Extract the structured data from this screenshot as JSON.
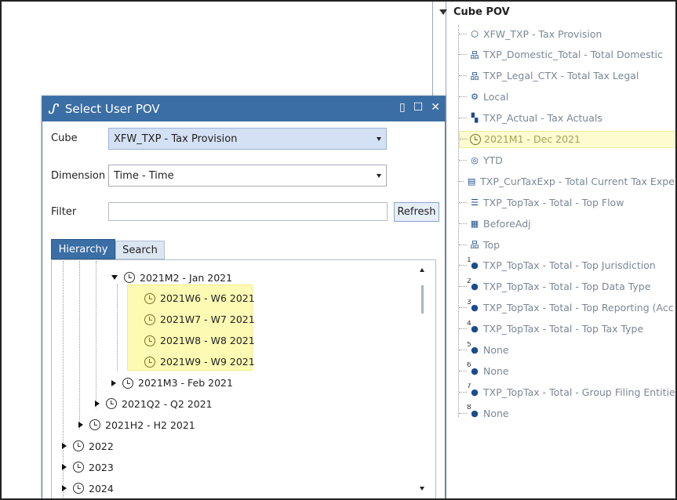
{
  "cube_pov": {
    "header": "Cube POV",
    "items": [
      {
        "label": "XFW_TXP - Tax Provision",
        "icon": "cube-icon"
      },
      {
        "label": "TXP_Domestic_Total - Total Domestic",
        "icon": "entity-hierarchy-icon"
      },
      {
        "label": "TXP_Legal_CTX - Total Tax Legal",
        "icon": "entity-hierarchy-icon"
      },
      {
        "label": "Local",
        "icon": "consolidation-icon"
      },
      {
        "label": "TXP_Actual - Tax Actuals",
        "icon": "scenario-icon"
      },
      {
        "label": "2021M1 - Dec 2021",
        "icon": "clock-icon",
        "highlighted": true
      },
      {
        "label": "YTD",
        "icon": "view-icon"
      },
      {
        "label": "TXP_CurTaxExp - Total Current Tax Exper",
        "icon": "account-icon"
      },
      {
        "label": "TXP_TopTax - Total - Top Flow",
        "icon": "flow-icon"
      },
      {
        "label": "BeforeAdj",
        "icon": "origin-icon"
      },
      {
        "label": "Top",
        "icon": "ic-hierarchy-icon"
      },
      {
        "label": "TXP_TopTax - Total - Top Jurisdiction",
        "icon": "ud1-icon",
        "num": "1"
      },
      {
        "label": "TXP_TopTax - Total - Top Data Type",
        "icon": "ud2-icon",
        "num": "2"
      },
      {
        "label": "TXP_TopTax - Total - Top Reporting (Acc",
        "icon": "ud3-icon",
        "num": "3"
      },
      {
        "label": "TXP_TopTax - Total - Top Tax Type",
        "icon": "ud4-icon",
        "num": "4"
      },
      {
        "label": "None",
        "icon": "ud5-icon",
        "num": "5"
      },
      {
        "label": "None",
        "icon": "ud6-icon",
        "num": "6"
      },
      {
        "label": "TXP_TopTax - Total - Group Filing Entitie",
        "icon": "ud7-icon",
        "num": "7"
      },
      {
        "label": "None",
        "icon": "ud8-icon",
        "num": "8"
      }
    ]
  },
  "dialog": {
    "title": "Select User POV",
    "cube_label": "Cube",
    "cube_value": "XFW_TXP - Tax Provision",
    "dimension_label": "Dimension",
    "dimension_value": "Time - Time",
    "filter_label": "Filter",
    "filter_value": "",
    "refresh_label": "Refresh",
    "tabs": [
      "Hierarchy",
      "Search"
    ],
    "tree": [
      {
        "label": "2021M2 - Jan 2021",
        "level": 3,
        "state": "expanded"
      },
      {
        "label": "2021W6 - W6 2021",
        "level": 4,
        "state": "leaf",
        "highlighted": true
      },
      {
        "label": "2021W7 - W7 2021",
        "level": 4,
        "state": "leaf",
        "highlighted": true
      },
      {
        "label": "2021W8 - W8 2021",
        "level": 4,
        "state": "leaf",
        "highlighted": true
      },
      {
        "label": "2021W9 - W9 2021",
        "level": 4,
        "state": "leaf",
        "highlighted": true
      },
      {
        "label": "2021M3 - Feb 2021",
        "level": 3,
        "state": "collapsed"
      },
      {
        "label": "2021Q2 - Q2 2021",
        "level": 2,
        "state": "collapsed"
      },
      {
        "label": "2021H2 - H2 2021",
        "level": 1,
        "state": "collapsed"
      },
      {
        "label": "2022",
        "level": 0,
        "state": "collapsed"
      },
      {
        "label": "2023",
        "level": 0,
        "state": "collapsed"
      },
      {
        "label": "2024",
        "level": 0,
        "state": "collapsed"
      }
    ]
  }
}
